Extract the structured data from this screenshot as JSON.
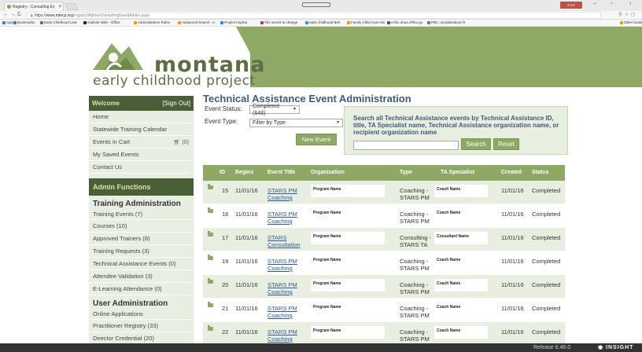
{
  "browser": {
    "tab_title": "Registry - Consulting Ev",
    "url_scheme": "https://",
    "url_domain": "www.mtecp.org",
    "url_path": "/registry/Admin/ConsultingEventAdmin.aspx",
    "user_badge": "ZTKS",
    "bookmarks": [
      {
        "label": "Apps",
        "color": "#3b78e7"
      },
      {
        "label": "Bookmarks",
        "color": "#3b78e7"
      },
      {
        "label": "Early Childhood Lear",
        "color": "#7a5d9a"
      },
      {
        "label": "Outlook Web - Office",
        "color": "#222222"
      },
      {
        "label": "Administrative Rules",
        "color": "#e0a000"
      },
      {
        "label": "Advanced Search - A",
        "color": "#e0a000"
      },
      {
        "label": "Project Implicit",
        "color": "#3b78e7"
      },
      {
        "label": "The secret to change",
        "color": "#d93025"
      },
      {
        "label": "early childhood Beh",
        "color": "#4285f4"
      },
      {
        "label": "Family Child Care Mo",
        "color": "#e0a000"
      },
      {
        "label": "ecfsc.ohua.cfhho.go",
        "color": "#555555"
      },
      {
        "label": "PBC considerations fr",
        "color": "#777777"
      },
      {
        "label": "Other bookmarks",
        "color": "#e0a000"
      }
    ]
  },
  "logo": {
    "name": "montana",
    "tagline": "early childhood project"
  },
  "sidebar": {
    "welcome": "Welcome",
    "sign_out": "[Sign Out]",
    "items": [
      {
        "label": "Home"
      },
      {
        "label": "Statewide Training Calendar"
      },
      {
        "label": "Events in Cart",
        "count": "(0)"
      },
      {
        "label": "My Saved Events"
      },
      {
        "label": "Contact Us"
      }
    ],
    "admin_functions": "Admin Functions",
    "training_admin_title": "Training Administration",
    "training_admin_items": [
      "Training Events (7)",
      "Courses (10)",
      "Approved Trainers (8)",
      "Training Requests (3)",
      "Technical Assistance Events (0)",
      "Attendee Validation (3)",
      "E-Learning Attendance (0)"
    ],
    "user_admin_title": "User Administration",
    "user_admin_items": [
      "Online Applications",
      "Practitioner Registry (33)",
      "Director Credential (20)"
    ]
  },
  "main": {
    "title": "Technical Assistance Event Administration",
    "event_status_label": "Event Status:",
    "event_status_value": "Completed (648)",
    "event_type_label": "Event Type:",
    "event_type_value": "Filter by Type",
    "new_event": "New Event",
    "search_hint": "Search all Technical Assistance events by Technical Assistance ID, title, TA Specialist name, Technical Assistance organization name, or recipient organization name",
    "search_button": "Search",
    "reset_button": "Reset"
  },
  "table": {
    "headers": [
      "ID",
      "Begins",
      "Event Title",
      "Organization",
      "Type",
      "TA Specialist",
      "Created",
      "Status"
    ],
    "rows": [
      {
        "id": "15",
        "begins": "11/01/16",
        "title": "STARS PM Coaching",
        "org": "Program Name",
        "type": "Coaching - STARS PM",
        "spec": "Coach Name",
        "created": "11/01/16",
        "status": "Completed"
      },
      {
        "id": "16",
        "begins": "11/01/16",
        "title": "STARS PM Coaching",
        "org": "Program Name",
        "type": "Coaching - STARS PM",
        "spec": "Coach Name",
        "created": "11/01/16",
        "status": "Completed"
      },
      {
        "id": "17",
        "begins": "11/01/16",
        "title": "STARS Consultation",
        "org": "Program Name",
        "type": "Consulting - STARS TA",
        "spec": "Consultant Name",
        "created": "11/01/16",
        "status": "Completed"
      },
      {
        "id": "19",
        "begins": "11/01/16",
        "title": "STARS PM Coaching",
        "org": "Program Name",
        "type": "Coaching - STARS PM",
        "spec": "Coach Name",
        "created": "11/01/16",
        "status": "Completed"
      },
      {
        "id": "20",
        "begins": "11/01/16",
        "title": "STARS PM Coaching",
        "org": "Program Name",
        "type": "Coaching - STARS PM",
        "spec": "Coach Name",
        "created": "11/01/16",
        "status": "Completed"
      },
      {
        "id": "21",
        "begins": "11/01/16",
        "title": "STARS PM Coaching",
        "org": "Program Name",
        "type": "Coaching - STARS PM",
        "spec": "Coach Name",
        "created": "11/01/16",
        "status": "Completed"
      },
      {
        "id": "22",
        "begins": "11/01/16",
        "title": "STARS PM Coaching",
        "org": "Program Name",
        "type": "Coaching - STARS PM",
        "spec": "Coach Name",
        "created": "11/01/16",
        "status": "Completed"
      }
    ]
  },
  "footer": {
    "release": "Release 6.46.0",
    "brand": "INSIGHT"
  },
  "colors": {
    "brand_green": "#8ea865",
    "dark_green": "#4a5e37",
    "title_blue": "#3f5a7a",
    "link_blue": "#2f5a9a"
  }
}
